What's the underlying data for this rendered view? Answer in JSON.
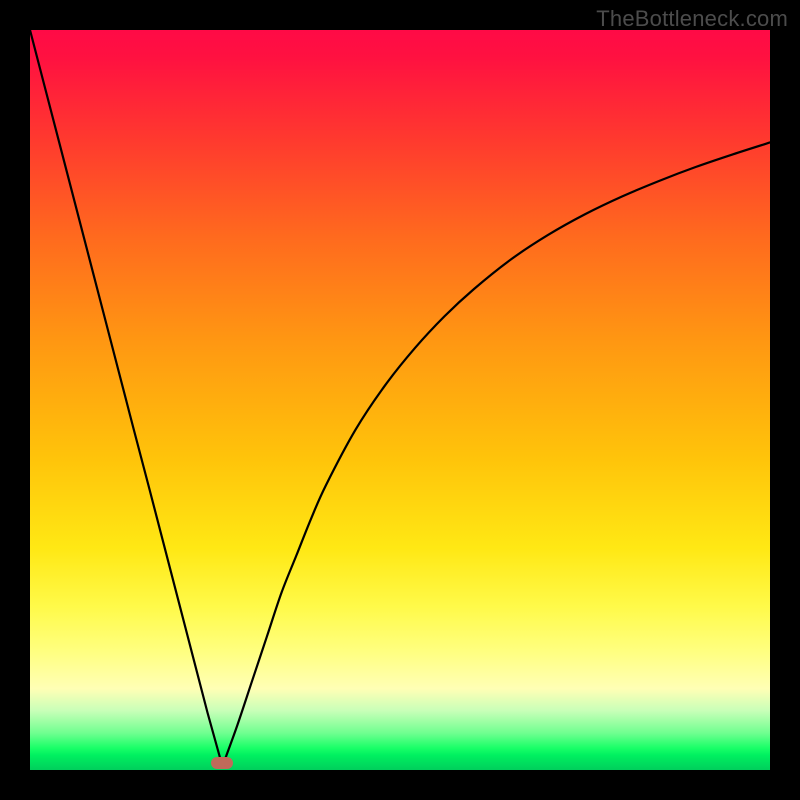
{
  "watermark": "TheBottleneck.com",
  "colors": {
    "background": "#000000",
    "curve": "#000000",
    "marker": "#c06a5a"
  },
  "chart_data": {
    "type": "line",
    "title": "",
    "xlabel": "",
    "ylabel": "",
    "xlim": [
      0,
      100
    ],
    "ylim": [
      0,
      100
    ],
    "grid": false,
    "legend": false,
    "annotations": [
      {
        "name": "optimal-marker",
        "x": 26,
        "y": 1
      }
    ],
    "series": [
      {
        "name": "left-branch",
        "x": [
          0,
          2,
          4,
          6,
          8,
          10,
          12,
          14,
          16,
          18,
          20,
          22,
          24,
          26
        ],
        "y": [
          100,
          92.3,
          84.6,
          76.9,
          69.2,
          61.5,
          53.8,
          46.1,
          38.5,
          30.8,
          23.1,
          15.4,
          7.7,
          0.5
        ]
      },
      {
        "name": "right-branch",
        "x": [
          26,
          28,
          30,
          32,
          34,
          36,
          38,
          40,
          44,
          48,
          52,
          56,
          60,
          65,
          70,
          75,
          80,
          85,
          90,
          95,
          100
        ],
        "y": [
          0.5,
          6,
          12,
          18,
          24,
          29,
          34,
          38.5,
          46,
          52,
          57,
          61.3,
          65,
          69,
          72.3,
          75.1,
          77.5,
          79.6,
          81.5,
          83.2,
          84.8
        ]
      }
    ]
  }
}
